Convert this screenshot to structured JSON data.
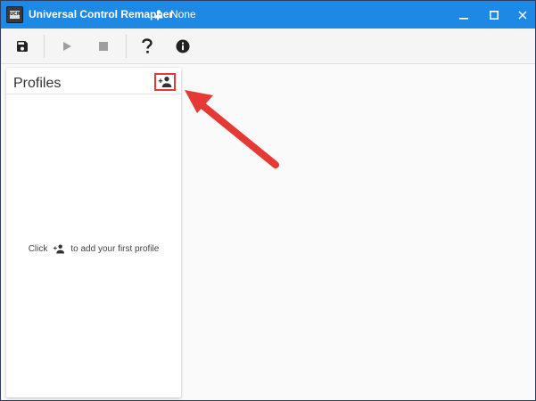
{
  "window": {
    "title": "Universal Control Remapper",
    "app_icon_text": "UCR",
    "active_profile": "None",
    "accent_color": "#1e88e5"
  },
  "toolbar": {
    "buttons": [
      {
        "name": "save",
        "icon": "save-icon"
      },
      {
        "name": "play",
        "icon": "play-icon"
      },
      {
        "name": "stop",
        "icon": "stop-icon"
      },
      {
        "name": "help",
        "icon": "help-icon"
      },
      {
        "name": "info",
        "icon": "info-icon"
      }
    ]
  },
  "profiles": {
    "title": "Profiles",
    "add_button_icon": "add-user-icon",
    "empty_hint": {
      "before": "Click",
      "after": "to add your first profile"
    }
  },
  "annotation": {
    "highlight_color": "#e53935"
  }
}
